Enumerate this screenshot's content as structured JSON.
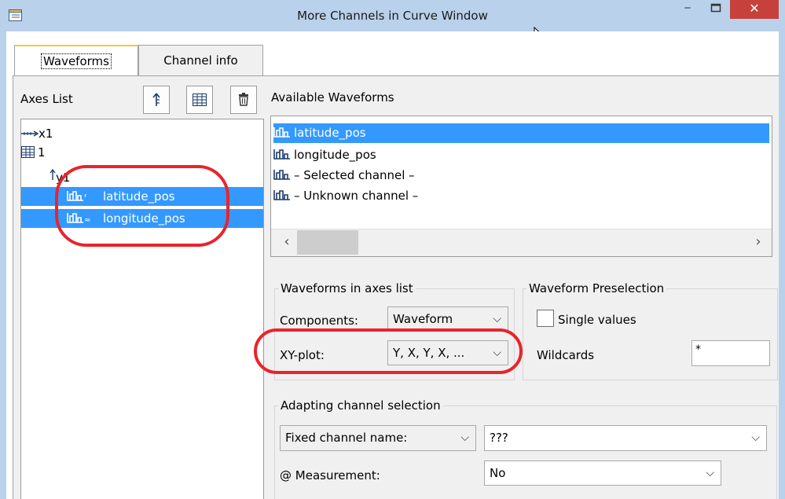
{
  "window": {
    "title": "More Channels in Curve Window",
    "minimize": "‒",
    "close": "✕"
  },
  "tabs": [
    "Waveforms",
    "Channel info"
  ],
  "axes_list": {
    "label": "Axes List",
    "toolbar_icons": [
      "move-up-icon",
      "table-icon",
      "delete-icon"
    ],
    "tree": [
      {
        "label": "x1",
        "icon": "x-axis-icon"
      },
      {
        "label": "1",
        "icon": "table-icon"
      },
      {
        "label": "y1",
        "icon": "y-axis-icon"
      },
      {
        "label": "latitude_pos",
        "icon": "waveform-icon",
        "selected": true
      },
      {
        "label": "longitude_pos",
        "icon": "waveform-icon",
        "selected": true
      }
    ]
  },
  "available_waveforms": {
    "label": "Available Waveforms",
    "items": [
      "latitude_pos",
      "longitude_pos",
      "– Selected channel –",
      "– Unknown channel –"
    ],
    "selected_index": 0
  },
  "waveforms_in_axes": {
    "legend": "Waveforms in axes list",
    "components_label": "Components:",
    "components_value": "Waveform",
    "xy_label": "XY-plot:",
    "xy_value": "Y, X, Y, X, ..."
  },
  "preselection": {
    "legend": "Waveform Preselection",
    "single_values_label": "Single values",
    "single_values_checked": false,
    "wildcards_label": "Wildcards",
    "wildcards_value": "*"
  },
  "adapting": {
    "legend": "Adapting channel selection",
    "mode_value": "Fixed channel name:",
    "channel_value": "???",
    "measurement_label": "@ Measurement:",
    "measurement_value": "No"
  },
  "colors": {
    "selection": "#3399ff",
    "annotation": "#e8242c",
    "titlebar": "#b9d1ea",
    "close": "#c7413c"
  }
}
